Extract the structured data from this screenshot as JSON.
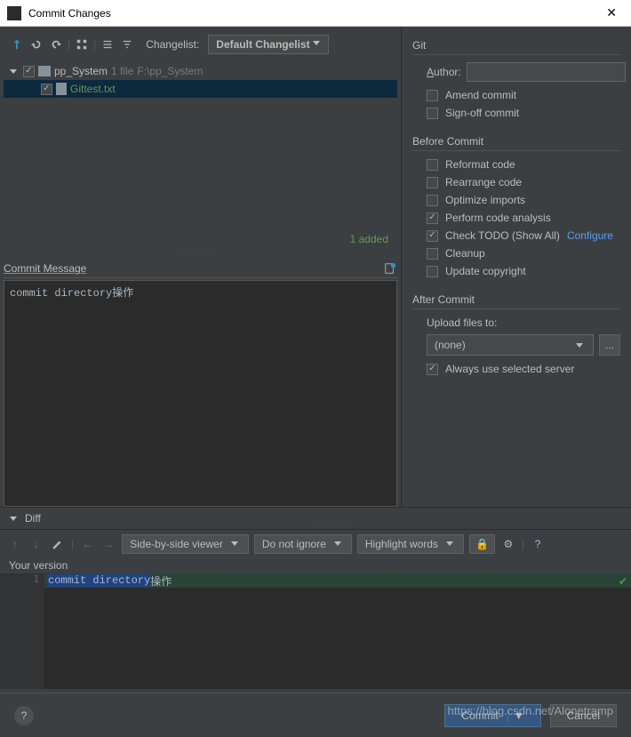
{
  "window": {
    "title": "Commit Changes"
  },
  "toolbar": {
    "changelist_label": "Changelist:",
    "changelist_value": "Default Changelist"
  },
  "tree": {
    "root_name": "pp_System",
    "root_info": "1 file",
    "root_path": "F:\\pp_System",
    "file_name": "Gittest.txt",
    "status": "1 added"
  },
  "commit": {
    "header": "Commit Message",
    "message": "commit directory操作"
  },
  "git": {
    "section": "Git",
    "author_label": "Author:",
    "amend": "Amend commit",
    "signoff": "Sign-off commit"
  },
  "before": {
    "section": "Before Commit",
    "reformat": "Reformat code",
    "rearrange": "Rearrange code",
    "optimize": "Optimize imports",
    "analysis": "Perform code analysis",
    "todo": "Check TODO (Show All)",
    "configure": "Configure",
    "cleanup": "Cleanup",
    "copyright": "Update copyright"
  },
  "after": {
    "section": "After Commit",
    "upload_label": "Upload files to:",
    "upload_value": "(none)",
    "always": "Always use selected server"
  },
  "diff": {
    "header": "Diff",
    "viewer": "Side-by-side viewer",
    "ignore": "Do not ignore",
    "highlight": "Highlight words",
    "version_label": "Your version",
    "code_selected": "commit directory",
    "code_rest": "操作",
    "line_number": "1"
  },
  "footer": {
    "commit": "Commit",
    "cancel": "Cancel"
  },
  "watermark": "https://blog.csdn.net/Alonetramp"
}
